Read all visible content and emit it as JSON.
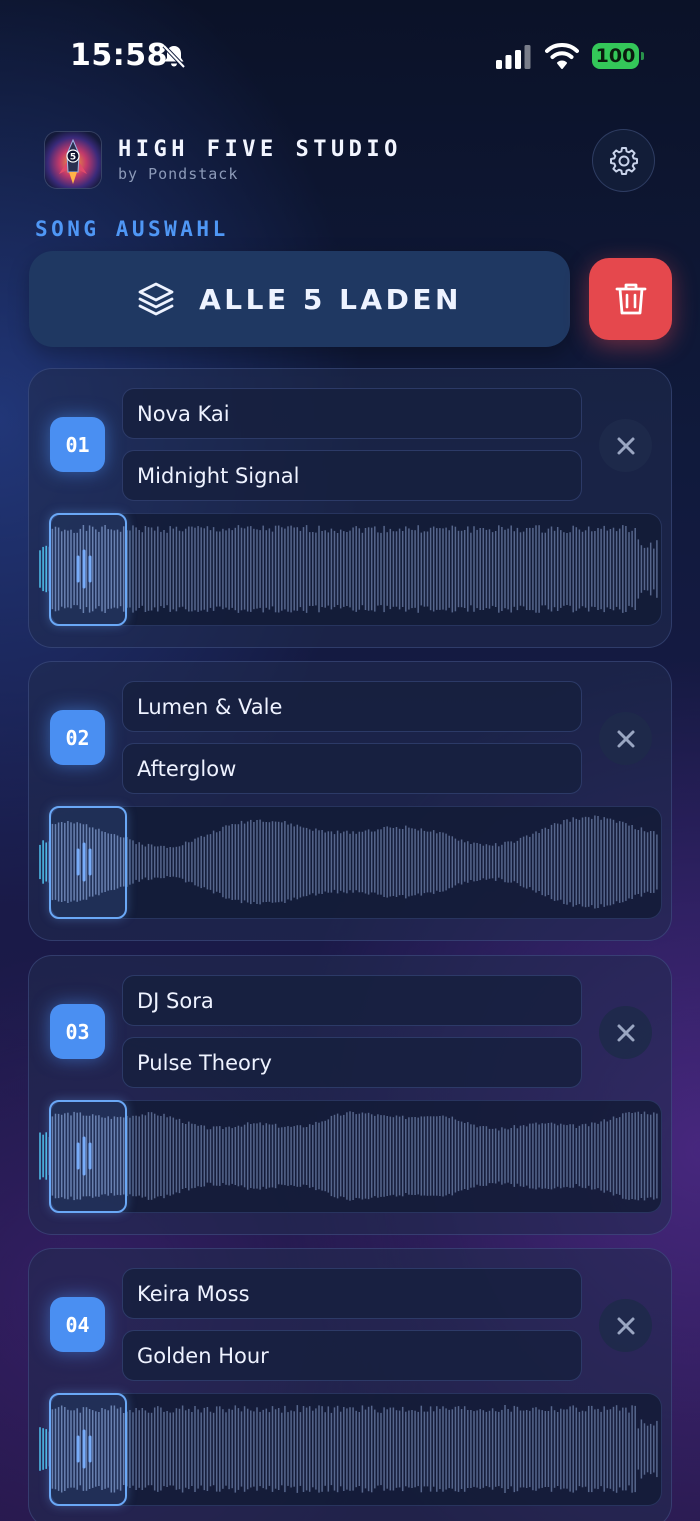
{
  "status_bar": {
    "time": "15:58",
    "battery_percent": "100",
    "icons": [
      "bell-slash-icon",
      "cellular-signal-icon",
      "wifi-icon",
      "battery-icon"
    ]
  },
  "header": {
    "title": "HIGH FIVE STUDIO",
    "subtitle": "by Pondstack",
    "logo_badge": "5",
    "settings_icon": "gear-icon"
  },
  "section": {
    "label": "SONG AUSWAHL"
  },
  "actions": {
    "load_all_label": "ALLE 5 LADEN",
    "load_all_icon": "layers-icon",
    "delete_icon": "trash-icon"
  },
  "colors": {
    "accent_blue": "#4a8ff2",
    "label_blue": "#4f97f5",
    "danger_red": "#e5484d",
    "battery_green": "#34c759"
  },
  "songs": [
    {
      "number": "01",
      "artist": "Nova Kai",
      "title": "Midnight Signal",
      "remove_icon": "close-icon"
    },
    {
      "number": "02",
      "artist": "Lumen & Vale",
      "title": "Afterglow",
      "remove_icon": "close-icon"
    },
    {
      "number": "03",
      "artist": "DJ Sora",
      "title": "Pulse Theory",
      "remove_icon": "close-icon"
    },
    {
      "number": "04",
      "artist": "Keira Moss",
      "title": "Golden Hour",
      "remove_icon": "close-icon"
    }
  ]
}
